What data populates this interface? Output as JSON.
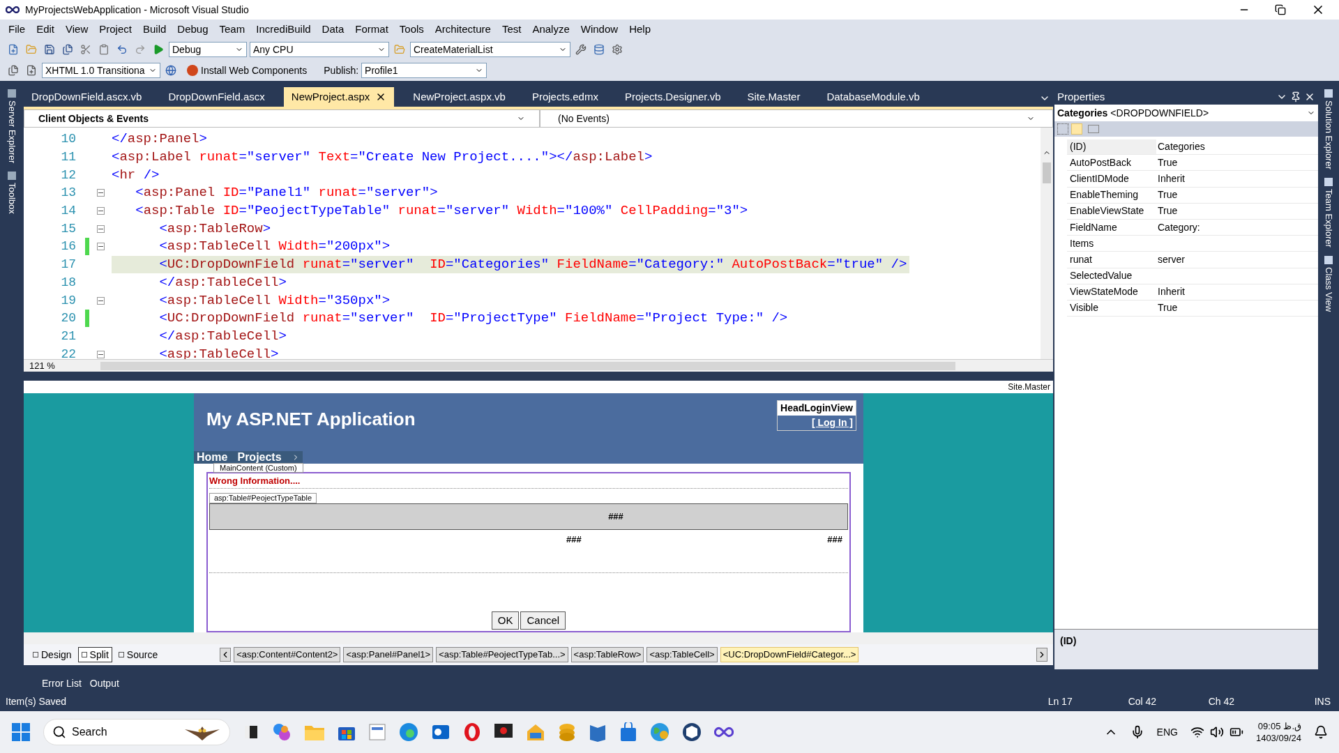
{
  "window": {
    "title": "MyProjectsWebApplication - Microsoft Visual Studio"
  },
  "menu": [
    "File",
    "Edit",
    "View",
    "Project",
    "Build",
    "Debug",
    "Team",
    "IncrediBuild",
    "Data",
    "Format",
    "Tools",
    "Architecture",
    "Test",
    "Analyze",
    "Window",
    "Help"
  ],
  "toolbar": {
    "configuration": "Debug",
    "platform": "Any CPU",
    "startup": "CreateMaterialList",
    "doctype": "XHTML 1.0 Transitiona",
    "install": "Install Web Components",
    "publish_label": "Publish:",
    "publish": "Profile1"
  },
  "tabs": [
    {
      "label": "DropDownField.ascx.vb",
      "selected": false
    },
    {
      "label": "DropDownField.ascx",
      "selected": false
    },
    {
      "label": "NewProject.aspx",
      "selected": true
    },
    {
      "label": "NewProject.aspx.vb",
      "selected": false
    },
    {
      "label": "Projects.edmx",
      "selected": false
    },
    {
      "label": "Projects.Designer.vb",
      "selected": false
    },
    {
      "label": "Site.Master",
      "selected": false
    },
    {
      "label": "DatabaseModule.vb",
      "selected": false
    }
  ],
  "editor": {
    "objects": "Client Objects & Events",
    "events": "(No Events)",
    "zoom": "121 %",
    "lines": [
      {
        "number": "10",
        "code": "</asp:Panel>",
        "fold": false,
        "changed": false,
        "current": false
      },
      {
        "number": "11",
        "code": "<asp:Label runat=\"server\" Text=\"Create New Project....\"></asp:Label>",
        "fold": false,
        "changed": false,
        "current": false
      },
      {
        "number": "12",
        "code": "<hr />",
        "fold": false,
        "changed": false,
        "current": false
      },
      {
        "number": "13",
        "code": "   <asp:Panel ID=\"Panel1\" runat=\"server\">",
        "fold": true,
        "changed": false,
        "current": false
      },
      {
        "number": "14",
        "code": "   <asp:Table ID=\"PeojectTypeTable\" runat=\"server\" Width=\"100%\" CellPadding=\"3\">",
        "fold": true,
        "changed": false,
        "current": false
      },
      {
        "number": "15",
        "code": "      <asp:TableRow>",
        "fold": true,
        "changed": false,
        "current": false
      },
      {
        "number": "16",
        "code": "      <asp:TableCell Width=\"200px\">",
        "fold": true,
        "changed": true,
        "current": false
      },
      {
        "number": "17",
        "code": "      <UC:DropDownField runat=\"server\"  ID=\"Categories\" FieldName=\"Category:\" AutoPostBack=\"true\" />",
        "fold": false,
        "changed": false,
        "current": true
      },
      {
        "number": "18",
        "code": "      </asp:TableCell>",
        "fold": false,
        "changed": false,
        "current": false
      },
      {
        "number": "19",
        "code": "      <asp:TableCell Width=\"350px\">",
        "fold": true,
        "changed": false,
        "current": false
      },
      {
        "number": "20",
        "code": "      <UC:DropDownField runat=\"server\"  ID=\"ProjectType\" FieldName=\"Project Type:\" />",
        "fold": false,
        "changed": true,
        "current": false
      },
      {
        "number": "21",
        "code": "      </asp:TableCell>",
        "fold": false,
        "changed": false,
        "current": false
      },
      {
        "number": "22",
        "code": "      <asp:TableCell>",
        "fold": true,
        "changed": false,
        "current": false
      }
    ]
  },
  "design": {
    "master": "Site.Master",
    "site_title": "My ASP.NET Application",
    "login_view": "HeadLoginView",
    "login_link": "[ Log In ]",
    "nav": [
      "Home",
      "Projects"
    ],
    "content_tag": "MainContent (Custom)",
    "error_text": "Wrong Information....",
    "table_tag": "asp:Table#PeojectTypeTable",
    "cells": [
      "###",
      "###",
      "###"
    ],
    "buttons": [
      "OK",
      "Cancel"
    ]
  },
  "view_tabs": [
    {
      "label": "Design",
      "selected": false
    },
    {
      "label": "Split",
      "selected": true
    },
    {
      "label": "Source",
      "selected": false
    }
  ],
  "breadcrumbs": [
    {
      "label": "<asp:Content#Content2>",
      "selected": false
    },
    {
      "label": "<asp:Panel#Panel1>",
      "selected": false
    },
    {
      "label": "<asp:Table#PeojectTypeTab...>",
      "selected": false
    },
    {
      "label": "<asp:TableRow>",
      "selected": false
    },
    {
      "label": "<asp:TableCell>",
      "selected": false
    },
    {
      "label": "<UC:DropDownField#Categor...>",
      "selected": true
    }
  ],
  "left_panels": [
    "Server Explorer",
    "Toolbox"
  ],
  "right_panels": [
    "Solution Explorer",
    "Team Explorer",
    "Class View"
  ],
  "properties": {
    "title": "Properties",
    "object_name": "Categories",
    "object_type": "<DROPDOWNFIELD>",
    "rows": [
      {
        "name": "(ID)",
        "value": "Categories"
      },
      {
        "name": "AutoPostBack",
        "value": "True"
      },
      {
        "name": "ClientIDMode",
        "value": "Inherit"
      },
      {
        "name": "EnableTheming",
        "value": "True"
      },
      {
        "name": "EnableViewState",
        "value": "True"
      },
      {
        "name": "FieldName",
        "value": "Category:"
      },
      {
        "name": "Items",
        "value": ""
      },
      {
        "name": "runat",
        "value": "server"
      },
      {
        "name": "SelectedValue",
        "value": ""
      },
      {
        "name": "ViewStateMode",
        "value": "Inherit"
      },
      {
        "name": "Visible",
        "value": "True"
      }
    ],
    "description": "(ID)"
  },
  "bottom_tabs": [
    "Error List",
    "Output"
  ],
  "status": {
    "message": "Item(s) Saved",
    "ln": "Ln 17",
    "col": "Col 42",
    "ch": "Ch 42",
    "mode": "INS"
  },
  "taskbar": {
    "search": "Search",
    "language": "ENG",
    "time": "09:05",
    "period": "ق.ظ",
    "date": "1403/09/24"
  }
}
